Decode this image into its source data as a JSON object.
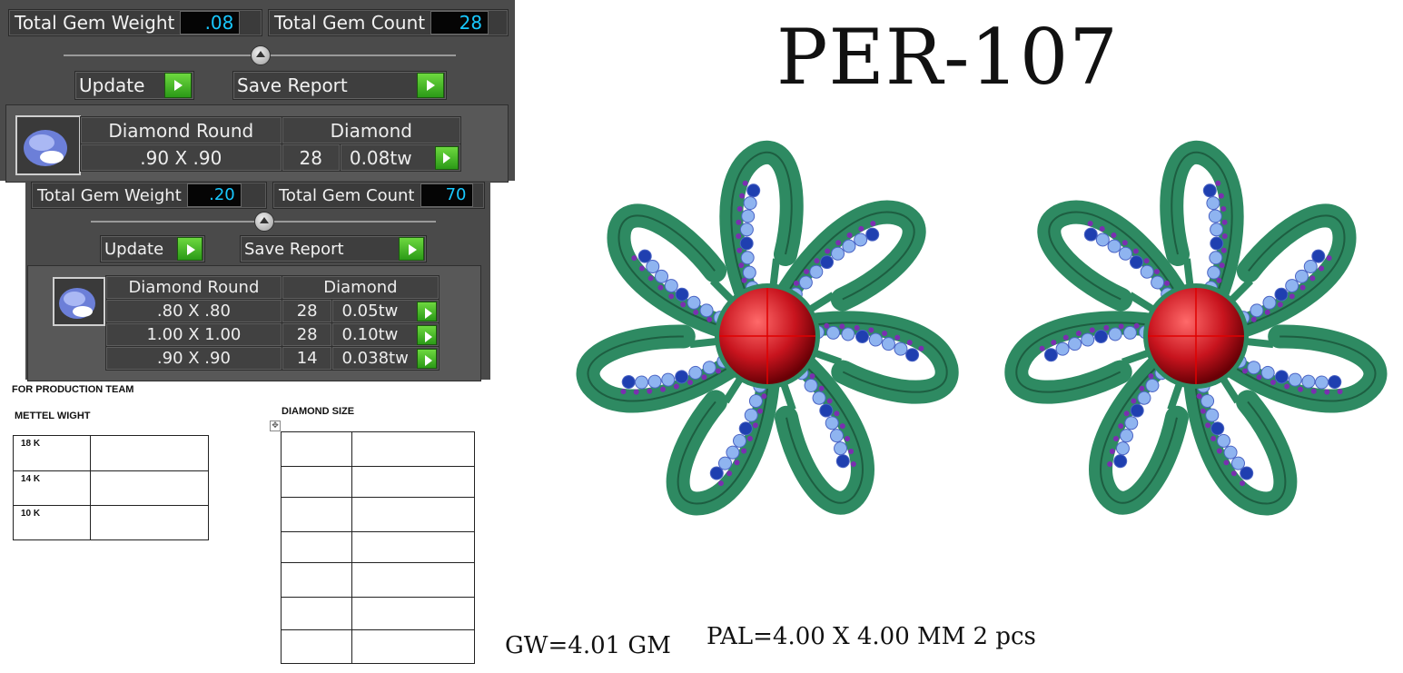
{
  "panel_top": {
    "total_gem_weight_label": "Total Gem Weight",
    "total_gem_weight_value": ".08",
    "total_gem_count_label": "Total Gem Count",
    "total_gem_count_value": "28",
    "update_label": "Update",
    "save_report_label": "Save Report",
    "table": {
      "shape": "Diamond Round",
      "type": "Diamond",
      "rows": [
        {
          "size": ".90 X .90",
          "count": "28",
          "tw": "0.08tw"
        }
      ]
    }
  },
  "panel_bottom": {
    "total_gem_weight_label": "Total Gem Weight",
    "total_gem_weight_value": ".20",
    "total_gem_count_label": "Total Gem Count",
    "total_gem_count_value": "70",
    "update_label": "Update",
    "save_report_label": "Save Report",
    "table": {
      "shape": "Diamond Round",
      "type": "Diamond",
      "rows": [
        {
          "size": ".80 X .80",
          "count": "28",
          "tw": "0.05tw"
        },
        {
          "size": "1.00 X 1.00",
          "count": "28",
          "tw": "0.10tw"
        },
        {
          "size": ".90 X .90",
          "count": "14",
          "tw": "0.038tw"
        }
      ]
    }
  },
  "production": {
    "heading": "FOR PRODUCTION TEAM",
    "metal_heading": "METTEL WIGHT",
    "diamond_heading": "DIAMOND SIZE",
    "metal_rows": [
      "18 K",
      "14 K",
      "10 K"
    ]
  },
  "design": {
    "code": "PER-107",
    "gross_weight": "GW=4.01  GM",
    "pearl_spec": "PAL=4.00  X  4.00  MM  2  pcs"
  },
  "colors": {
    "panel_bg": "#4b4b4b",
    "value_text": "#18c8ff",
    "play_green": "#3bb022",
    "metal_green": "#2e8a62",
    "stone_light": "#8fb4f0",
    "stone_dark": "#1f3fb0",
    "stone_purple": "#7a2fb0",
    "pearl_red": "#c8141e"
  }
}
